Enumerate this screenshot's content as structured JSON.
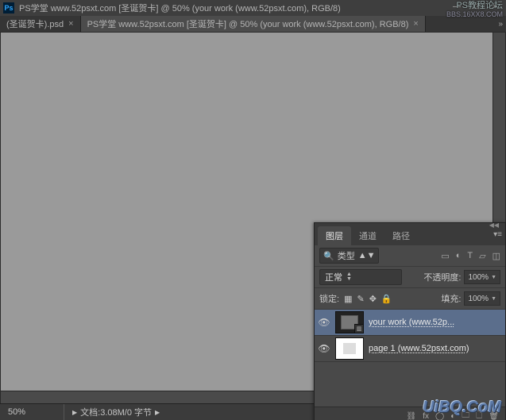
{
  "titlebar": {
    "text": "PS学堂 www.52psxt.com [圣诞贺卡] @ 50% (your work (www.52psxt.com), RGB/8)"
  },
  "window_controls": {
    "minimize": "—",
    "maximize": "□",
    "close": "×"
  },
  "file_tabs": [
    {
      "label": "(圣诞贺卡).psd",
      "close": "×",
      "active": false
    },
    {
      "label": "PS学堂 www.52psxt.com [圣诞贺卡] @ 50% (your work (www.52psxt.com), RGB/8)",
      "close": "×",
      "active": true
    }
  ],
  "tabbar_more": "»",
  "status": {
    "zoom": "50%",
    "doc_label": "文档:3.08M/0 字节"
  },
  "panel": {
    "collapse_icon": "◀◀",
    "tabs": {
      "layers": "图层",
      "channels": "通道",
      "paths": "路径"
    },
    "menu_icon": "▾≡",
    "filter": {
      "search_icon": "🔍",
      "type_label": "类型",
      "icons": {
        "image": "▭",
        "adjust": "◐",
        "type": "T",
        "shape": "▱",
        "smart": "◫"
      }
    },
    "blend": {
      "mode": "正常",
      "opacity_label": "不透明度:",
      "opacity_value": "100%"
    },
    "lock": {
      "label": "锁定:",
      "icons": {
        "pixels": "▦",
        "brush": "✎",
        "move": "✥",
        "all": "🔒"
      },
      "fill_label": "填充:",
      "fill_value": "100%"
    },
    "layers": [
      {
        "name": "your work (www.52p...",
        "selected": true
      },
      {
        "name": "page 1 (www.52psxt.com)",
        "selected": false
      }
    ],
    "footer_icons": {
      "link": "⛓",
      "fx": "fx",
      "mask": "◯",
      "adjust": "◐",
      "group": "🗀",
      "new": "🗋",
      "trash": "🗑"
    }
  },
  "watermark": {
    "top1": "PS教程论坛",
    "top2": "BBS.16XX8.COM",
    "bottom": "UiBQ.CoM"
  }
}
